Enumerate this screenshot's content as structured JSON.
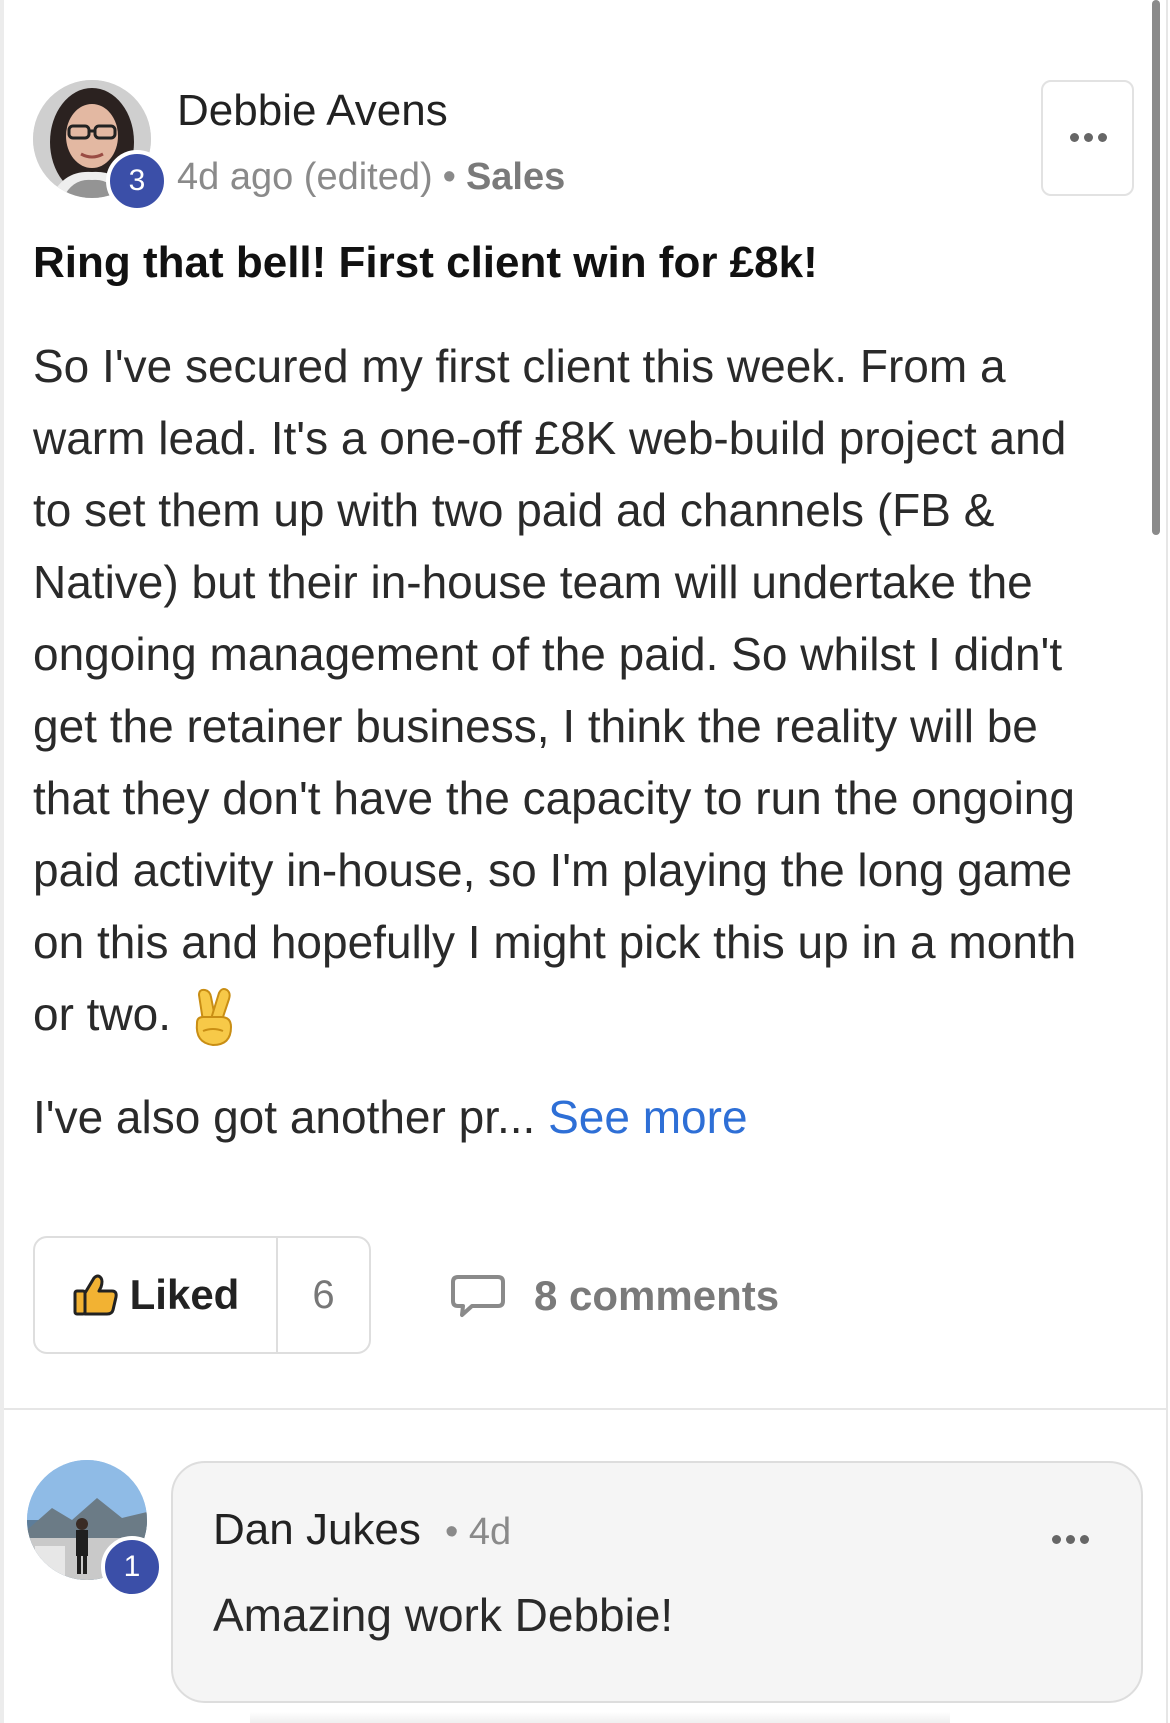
{
  "post": {
    "author": {
      "name": "Debbie Avens",
      "level": "3"
    },
    "time": "4d ago (edited)",
    "separator": "•",
    "category": "Sales",
    "title": "Ring that bell! First client win for £8k!",
    "body_lines": [
      "So I've secured my first client this week. From a",
      "warm lead. It's a one-off £8K web-build project and",
      "to set them up with two paid ad channels (FB &",
      "Native) but their in-house team will undertake the",
      "ongoing management of the paid. So whilst I didn't",
      "get the retainer business, I think the reality will be",
      "that they don't have the capacity to run the ongoing",
      "paid activity in-house, so I'm playing the long game",
      "on this and hopefully I might pick this up in a month",
      "or two."
    ],
    "emoji": "crossed-fingers-emoji",
    "truncated_text": "I've also got another pr...",
    "see_more_label": "See more",
    "like_label": "Liked",
    "like_count": "6",
    "comments_label": "8 comments"
  },
  "comment": {
    "author": "Dan Jukes",
    "level": "1",
    "separator": "•",
    "time": "4d",
    "text": "Amazing work Debbie!"
  },
  "icons": {
    "more": "more-horizontal-icon",
    "like": "thumbs-up-icon",
    "comment": "comment-bubble-icon"
  },
  "colors": {
    "level_badge": "#3b4fa8",
    "link": "#2e6fd6",
    "muted_text": "#8a8a8a",
    "comment_bg": "#f5f5f5"
  }
}
